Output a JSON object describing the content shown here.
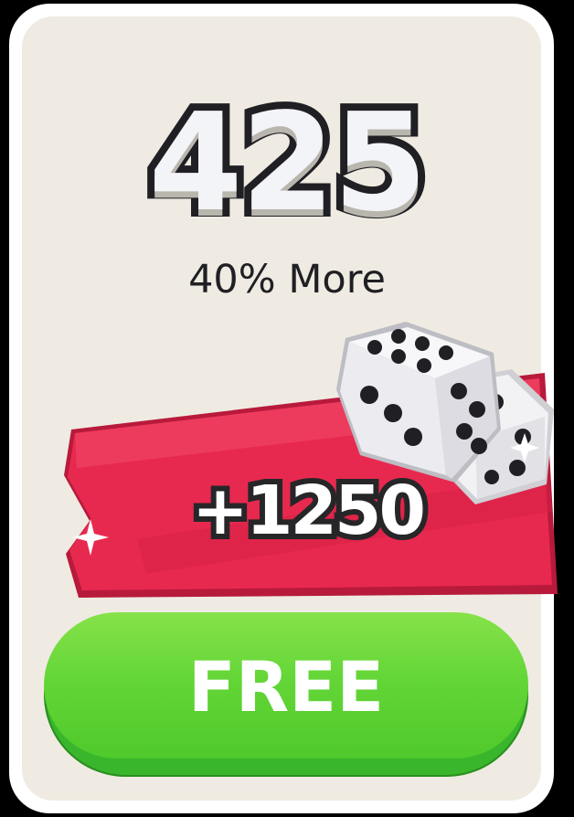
{
  "offer": {
    "amount": "425",
    "subtitle": "40% More",
    "bonus": "+1250",
    "button_label": "FREE",
    "bonus_item_icon": "dice-icon",
    "sparkle_icon": "sparkle-icon"
  },
  "colors": {
    "ribbon": "#e8294f",
    "button": "#5fd236",
    "card_background": "#efebe2",
    "card_border": "#ffffff"
  }
}
